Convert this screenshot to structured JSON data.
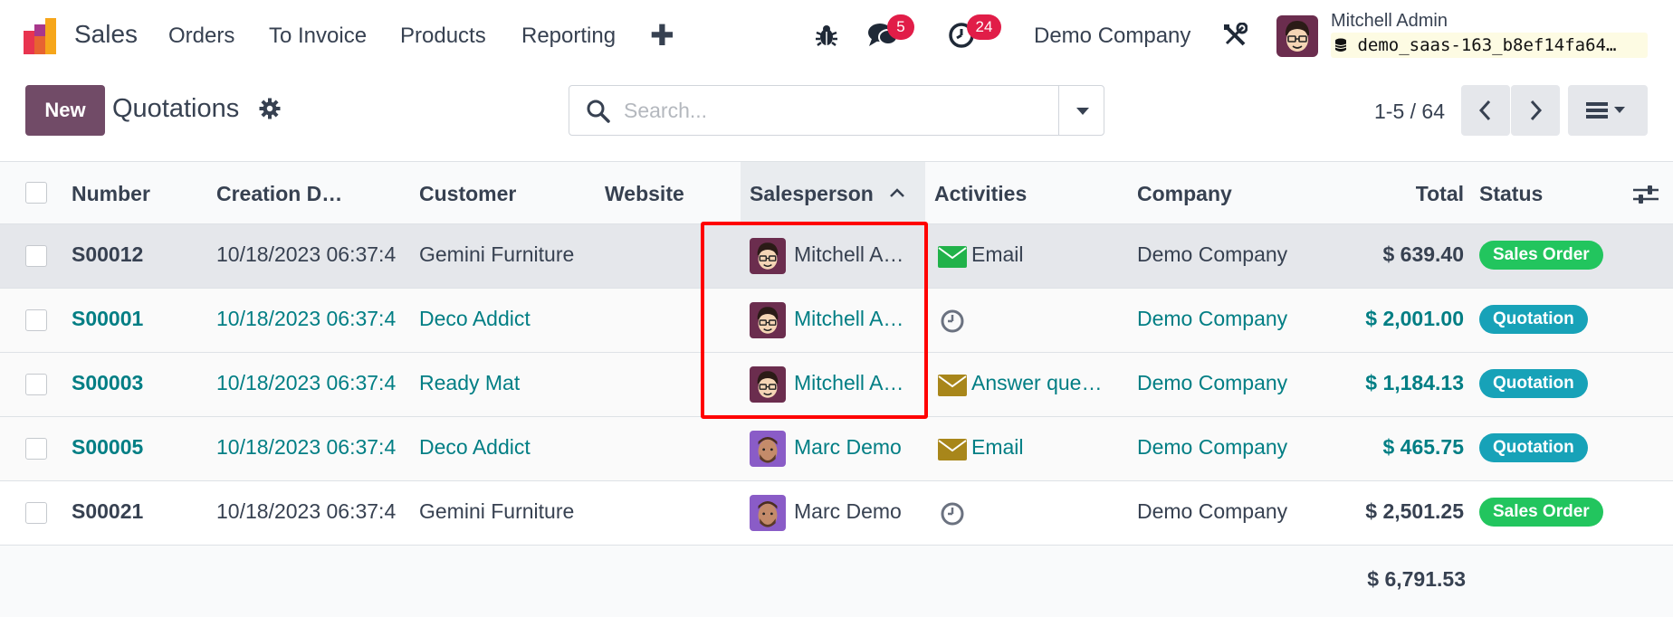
{
  "app": {
    "name": "Sales"
  },
  "nav": {
    "menu": [
      "Orders",
      "To Invoice",
      "Products",
      "Reporting"
    ],
    "messages_count": "5",
    "activities_count": "24",
    "company": "Demo Company",
    "user_name": "Mitchell Admin",
    "database": "demo_saas-163_b8ef14fa64…"
  },
  "control": {
    "new_label": "New",
    "title": "Quotations",
    "search_placeholder": "Search...",
    "pager": "1-5 / 64"
  },
  "columns": {
    "number": "Number",
    "creation_date": "Creation D…",
    "customer": "Customer",
    "website": "Website",
    "salesperson": "Salesperson",
    "activities": "Activities",
    "company": "Company",
    "total": "Total",
    "status": "Status"
  },
  "rows": [
    {
      "number": "S00012",
      "date": "10/18/2023 06:37:4",
      "customer": "Gemini Furniture",
      "salesperson": "Mitchell A…",
      "activity": "Email",
      "company": "Demo Company",
      "total": "$ 639.40",
      "status": "Sales Order"
    },
    {
      "number": "S00001",
      "date": "10/18/2023 06:37:4",
      "customer": "Deco Addict",
      "salesperson": "Mitchell A…",
      "activity": "",
      "company": "Demo Company",
      "total": "$ 2,001.00",
      "status": "Quotation"
    },
    {
      "number": "S00003",
      "date": "10/18/2023 06:37:4",
      "customer": "Ready Mat",
      "salesperson": "Mitchell A…",
      "activity": "Answer que…",
      "company": "Demo Company",
      "total": "$ 1,184.13",
      "status": "Quotation"
    },
    {
      "number": "S00005",
      "date": "10/18/2023 06:37:4",
      "customer": "Deco Addict",
      "salesperson": "Marc Demo",
      "activity": "Email",
      "company": "Demo Company",
      "total": "$ 465.75",
      "status": "Quotation"
    },
    {
      "number": "S00021",
      "date": "10/18/2023 06:37:4",
      "customer": "Gemini Furniture",
      "salesperson": "Marc Demo",
      "activity": "",
      "company": "Demo Company",
      "total": "$ 2,501.25",
      "status": "Sales Order"
    }
  ],
  "grand_total": "$ 6,791.53",
  "colors": {
    "brand": "#714b67",
    "link": "#017e84",
    "sales_order": "#22c55e",
    "quotation": "#17a2b8",
    "badge": "#e11d48",
    "highlight": "#ff0000"
  },
  "icons": [
    "app-logo-icon",
    "plus-icon",
    "bug-icon",
    "chat-icon",
    "clock-icon",
    "tools-icon",
    "database-icon",
    "gear-icon",
    "search-icon",
    "caret-down-icon",
    "chevron-left-icon",
    "chevron-right-icon",
    "list-view-icon",
    "sort-up-icon",
    "column-settings-icon",
    "envelope-icon"
  ]
}
